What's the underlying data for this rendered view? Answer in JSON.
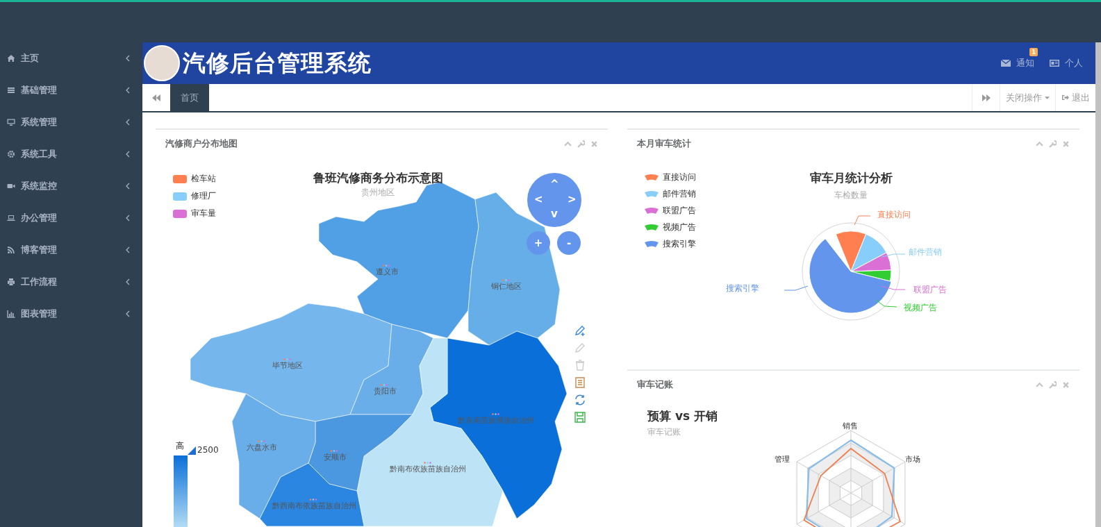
{
  "sidebar": {
    "items": [
      {
        "label": "主页"
      },
      {
        "label": "基础管理"
      },
      {
        "label": "系统管理"
      },
      {
        "label": "系统工具"
      },
      {
        "label": "系统监控"
      },
      {
        "label": "办公管理"
      },
      {
        "label": "博客管理"
      },
      {
        "label": "工作流程"
      },
      {
        "label": "图表管理"
      }
    ]
  },
  "header": {
    "title": "汽修后台管理系统",
    "notify": {
      "label": "通知",
      "badge": "1"
    },
    "profile": "个人"
  },
  "tabbar": {
    "tabs": [
      {
        "label": "首页",
        "selected": true
      }
    ],
    "close_menu": "关闭操作",
    "logout": "退出"
  },
  "map_panel": {
    "title": "汽修商户分布地图",
    "chart_title": "鲁班汽修商务分布示意图",
    "chart_subtitle": "贵州地区",
    "legend": [
      {
        "label": "检车站",
        "color": "#ff7f50"
      },
      {
        "label": "修理厂",
        "color": "#87cefa"
      },
      {
        "label": "审车量",
        "color": "#da70d6"
      }
    ],
    "regions": [
      {
        "name": "遵义市",
        "color": "#519fe4"
      },
      {
        "name": "铜仁地区",
        "color": "#66aee8"
      },
      {
        "name": "毕节地区",
        "color": "#75b6ec"
      },
      {
        "name": "贵阳市",
        "color": "#6aaee9"
      },
      {
        "name": "黔东南苗族侗族自治州",
        "color": "#0a6fd8"
      },
      {
        "name": "黔南布依族苗族自治州",
        "color": "#bde3f6"
      },
      {
        "name": "安顺市",
        "color": "#4b98e0"
      },
      {
        "name": "六盘水市",
        "color": "#6aaee9"
      },
      {
        "name": "黔西南布依族苗族自治州",
        "color": "#2a86e0"
      }
    ],
    "roam": {
      "up": "^",
      "left": "<",
      "right": ">",
      "down": "v",
      "zoom_in": "+",
      "zoom_out": "-"
    },
    "visual_map": {
      "high": "高",
      "max": "2500"
    }
  },
  "pie_panel": {
    "title": "本月审车统计",
    "chart_title": "审车月统计分析",
    "chart_subtitle": "车检数量",
    "legend": [
      {
        "label": "直接访问",
        "color": "#ff7f50"
      },
      {
        "label": "邮件营销",
        "color": "#87cefa"
      },
      {
        "label": "联盟广告",
        "color": "#da70d6"
      },
      {
        "label": "视频广告",
        "color": "#32cd32"
      },
      {
        "label": "搜索引擎",
        "color": "#6495ed"
      }
    ],
    "slice_labels": [
      {
        "label": "直接访问",
        "color": "#ff7f50"
      },
      {
        "label": "邮件营销",
        "color": "#87cefa"
      },
      {
        "label": "联盟广告",
        "color": "#da70d6"
      },
      {
        "label": "视频广告",
        "color": "#32cd32"
      },
      {
        "label": "搜索引擎",
        "color": "#6495ed"
      }
    ]
  },
  "radar_panel": {
    "title": "审车记账",
    "chart_title": "预算 vs 开销",
    "chart_subtitle": "审车记账",
    "axes": [
      "销售",
      "市场",
      "管理"
    ]
  }
}
